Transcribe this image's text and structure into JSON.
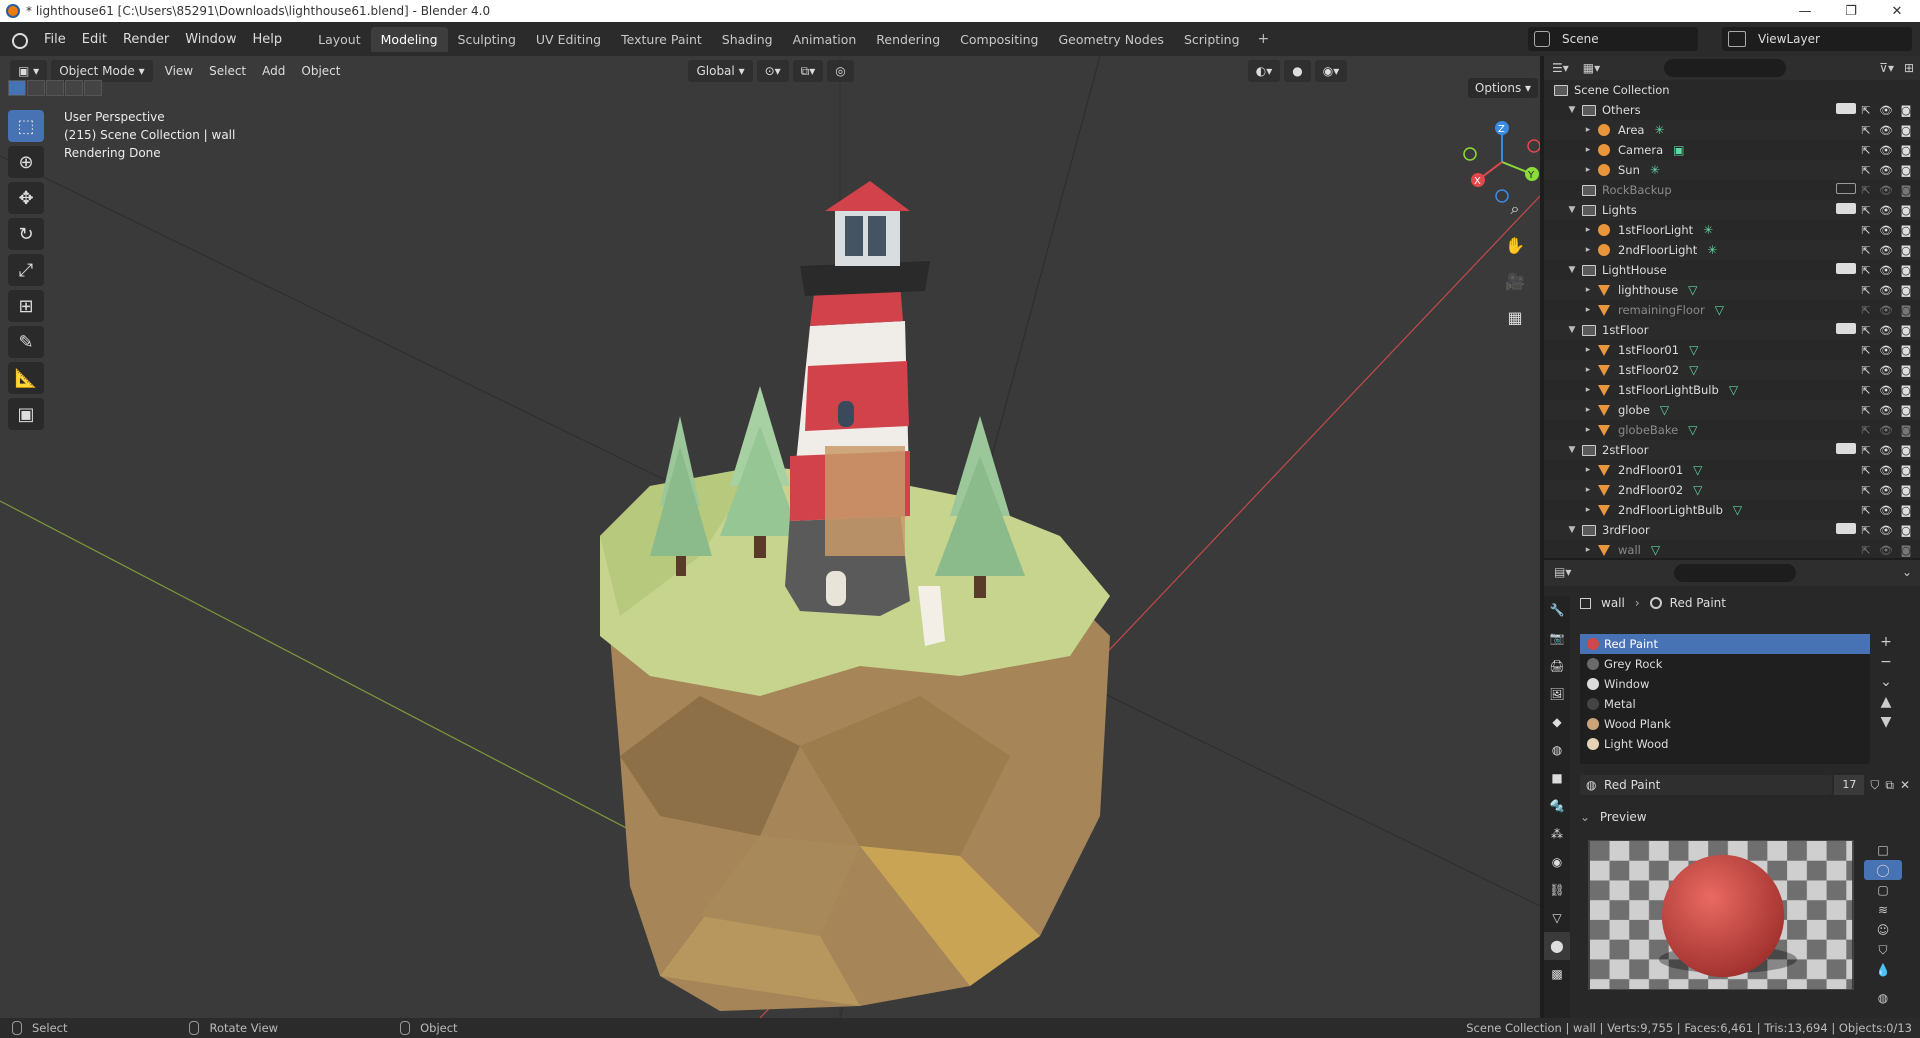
{
  "window": {
    "title": "* lighthouse61 [C:\\Users\\85291\\Downloads\\lighthouse61.blend] - Blender 4.0",
    "controls": [
      "—",
      "❐",
      "✕"
    ]
  },
  "menu": [
    "File",
    "Edit",
    "Render",
    "Window",
    "Help"
  ],
  "workspaces": {
    "tabs": [
      "Layout",
      "Modeling",
      "Sculpting",
      "UV Editing",
      "Texture Paint",
      "Shading",
      "Animation",
      "Rendering",
      "Compositing",
      "Geometry Nodes",
      "Scripting"
    ],
    "active": "Modeling",
    "add": "+"
  },
  "scene": {
    "name": "Scene",
    "view_layer": "ViewLayer"
  },
  "viewport": {
    "mode": "Object Mode",
    "menus": [
      "View",
      "Select",
      "Add",
      "Object"
    ],
    "transform": "Global",
    "options": "Options",
    "info": [
      "User Perspective",
      "(215) Scene Collection | wall",
      "Rendering Done"
    ],
    "gizmo": {
      "x": "X",
      "y": "Y",
      "z": "Z"
    }
  },
  "outliner": {
    "root": "Scene Collection",
    "rows": [
      {
        "name": "Others",
        "kind": "collection",
        "level": 0,
        "checked": true
      },
      {
        "name": "Area",
        "kind": "light",
        "level": 1
      },
      {
        "name": "Camera",
        "kind": "camera",
        "level": 1
      },
      {
        "name": "Sun",
        "kind": "light",
        "level": 1
      },
      {
        "name": "RockBackup",
        "kind": "collection",
        "level": 0,
        "dim": true,
        "checked": false
      },
      {
        "name": "Lights",
        "kind": "collection",
        "level": 0,
        "checked": true
      },
      {
        "name": "1stFloorLight",
        "kind": "light",
        "level": 1
      },
      {
        "name": "2ndFloorLight",
        "kind": "light",
        "level": 1
      },
      {
        "name": "LightHouse",
        "kind": "collection",
        "level": 0,
        "checked": true
      },
      {
        "name": "lighthouse",
        "kind": "mesh",
        "level": 1
      },
      {
        "name": "remainingFloor",
        "kind": "mesh",
        "level": 1,
        "dim": true
      },
      {
        "name": "1stFloor",
        "kind": "collection",
        "level": 0,
        "checked": true
      },
      {
        "name": "1stFloor01",
        "kind": "mesh",
        "level": 1
      },
      {
        "name": "1stFloor02",
        "kind": "mesh",
        "level": 1
      },
      {
        "name": "1stFloorLightBulb",
        "kind": "mesh",
        "level": 1
      },
      {
        "name": "globe",
        "kind": "mesh",
        "level": 1
      },
      {
        "name": "globeBake",
        "kind": "mesh",
        "level": 1,
        "dim": true
      },
      {
        "name": "2stFloor",
        "kind": "collection",
        "level": 0,
        "checked": true
      },
      {
        "name": "2ndFloor01",
        "kind": "mesh",
        "level": 1
      },
      {
        "name": "2ndFloor02",
        "kind": "mesh",
        "level": 1
      },
      {
        "name": "2ndFloorLightBulb",
        "kind": "mesh",
        "level": 1
      },
      {
        "name": "3rdFloor",
        "kind": "collection",
        "level": 0,
        "checked": true
      },
      {
        "name": "wall",
        "kind": "mesh",
        "level": 1,
        "dim": true
      }
    ]
  },
  "properties": {
    "breadcrumb": {
      "object": "wall",
      "material": "Red Paint"
    },
    "materials": [
      {
        "name": "Red Paint",
        "color": "#d04848",
        "active": true
      },
      {
        "name": "Grey Rock",
        "color": "#6a6a6a"
      },
      {
        "name": "Window",
        "color": "#dcdcdc"
      },
      {
        "name": "Metal",
        "color": "#444444"
      },
      {
        "name": "Wood Plank",
        "color": "#c9a37a"
      },
      {
        "name": "Light Wood",
        "color": "#e6d2b4"
      }
    ],
    "slot": {
      "name": "Red Paint",
      "users": "17"
    },
    "preview_label": "Preview",
    "preview_color": "#d9534f"
  },
  "status": {
    "hints": [
      "Select",
      "Rotate View",
      "Object"
    ],
    "right": "Scene Collection | wall | Verts:9,755 | Faces:6,461 | Tris:13,694 | Objects:0/13"
  },
  "colors": {
    "accent": "#4772b3",
    "mesh": "#e9953b",
    "data_icon": "#5ed8a2",
    "axis_x": "#e2474c",
    "axis_y": "#8bdc3a",
    "axis_z": "#3d8be0"
  }
}
